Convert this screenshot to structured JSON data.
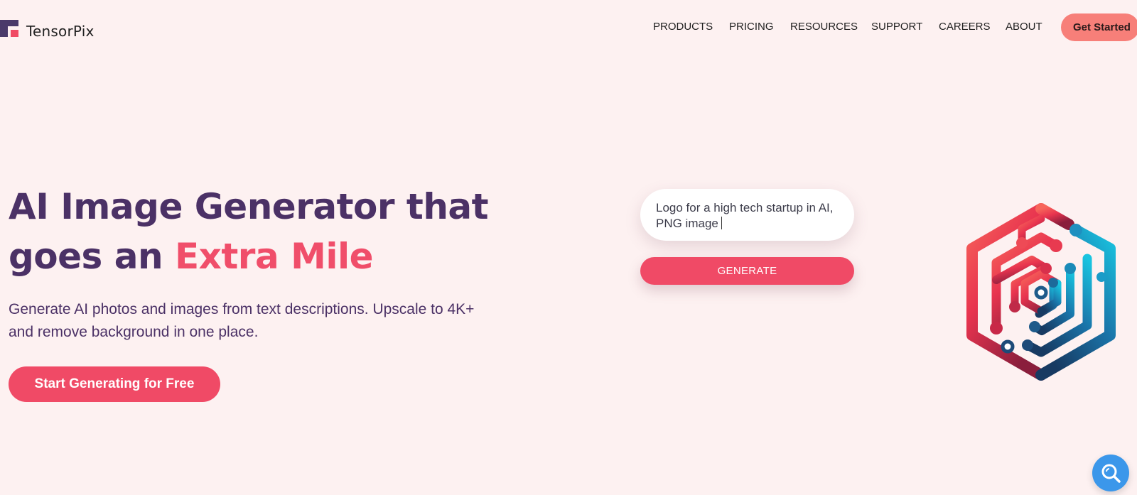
{
  "brand": {
    "name": "TensorPix"
  },
  "nav": {
    "items": [
      {
        "label": "PRODUCTS"
      },
      {
        "label": "PRICING"
      },
      {
        "label": "RESOURCES"
      },
      {
        "label": "SUPPORT"
      },
      {
        "label": "CAREERS"
      },
      {
        "label": "ABOUT"
      }
    ],
    "cta_label": "Get Started"
  },
  "hero": {
    "headline_line1": "AI Image Generator that",
    "headline_line2_start": "goes an",
    "headline_accent": "Extra Mile",
    "subtext": "Generate AI photos and images from text descriptions. Upscale to 4K+ and remove background in one place.",
    "cta_label": "Start Generating for Free"
  },
  "prompt": {
    "value": "Logo for a high tech startup in AI, PNG image",
    "button_label": "GENERATE"
  },
  "colors": {
    "background": "#fdf1f1",
    "brand_purple": "#4b3166",
    "accent_pink": "#f04a66",
    "get_started_bg": "#f77f79",
    "fab_blue": "#3b97ea"
  },
  "icons": {
    "logo": "tensorpix-logo-icon",
    "art": "hexagon-circuit-logo-icon",
    "fab": "search-icon"
  }
}
